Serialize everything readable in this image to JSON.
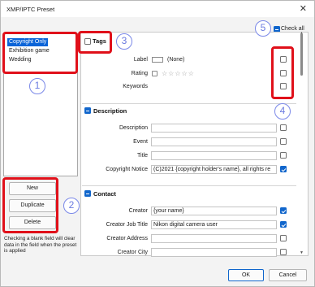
{
  "window": {
    "title": "XMP/IPTC Preset",
    "close_icon": "✕"
  },
  "presets": [
    "Copyright Only",
    "Exhibition game",
    "Wedding"
  ],
  "buttons": {
    "new": "New",
    "duplicate": "Duplicate",
    "delete": "Delete",
    "ok": "OK",
    "cancel": "Cancel"
  },
  "hint": "Checking a blank field will clear data in the field when the preset is applied",
  "check_all": "Check all",
  "tags": {
    "title": "Tags",
    "label_label": "Label",
    "label_value": "(None)",
    "rating_label": "Rating",
    "stars": "☆☆☆☆☆",
    "keywords_label": "Keywords"
  },
  "description": {
    "title": "Description",
    "rows": [
      {
        "label": "Description",
        "value": "",
        "checked": false
      },
      {
        "label": "Event",
        "value": "",
        "checked": false
      },
      {
        "label": "Title",
        "value": "",
        "checked": false
      },
      {
        "label": "Copyright Notice",
        "value": "(C)2021 {copyright holder's name}, all rights re",
        "checked": true
      }
    ]
  },
  "contact": {
    "title": "Contact",
    "rows": [
      {
        "label": "Creator",
        "value": "{your name}",
        "checked": true
      },
      {
        "label": "Creator Job Title",
        "value": "Nikon digital camera user",
        "checked": true
      },
      {
        "label": "Creator Address",
        "value": "",
        "checked": false
      },
      {
        "label": "Creator City",
        "value": "",
        "checked": false
      }
    ]
  },
  "annotations": [
    "1",
    "2",
    "3",
    "4",
    "5"
  ],
  "colors": {
    "accent": "#1166cc",
    "annotation_red": "#e0101a",
    "badge": "#6a7ae0"
  }
}
